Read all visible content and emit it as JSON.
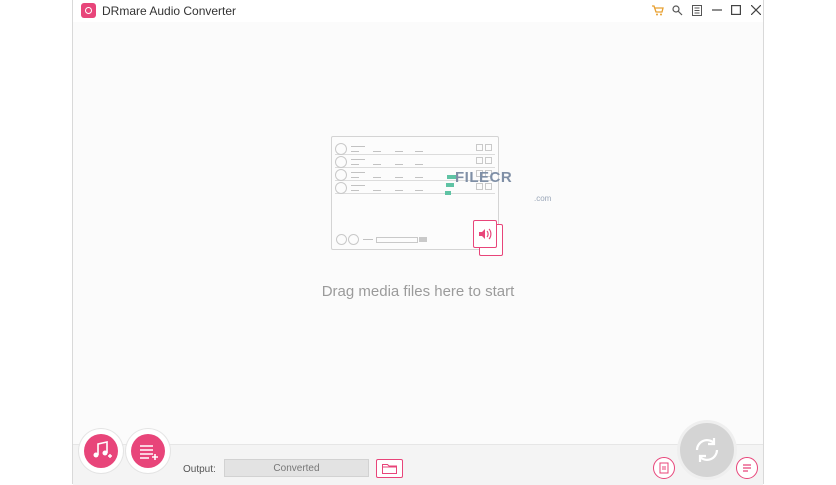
{
  "app": {
    "title": "DRmare Audio Converter"
  },
  "titlebar_icons": [
    "cart-icon",
    "key-icon",
    "menu-icon",
    "minimize-icon",
    "maximize-icon",
    "close-icon"
  ],
  "watermark": {
    "text": "FILECR",
    "sub": ".com"
  },
  "main": {
    "drag_hint": "Drag media files here to start"
  },
  "output": {
    "label": "Output:",
    "value": "Converted"
  },
  "colors": {
    "accent": "#e8457a",
    "convert": "#d4d4d4"
  }
}
